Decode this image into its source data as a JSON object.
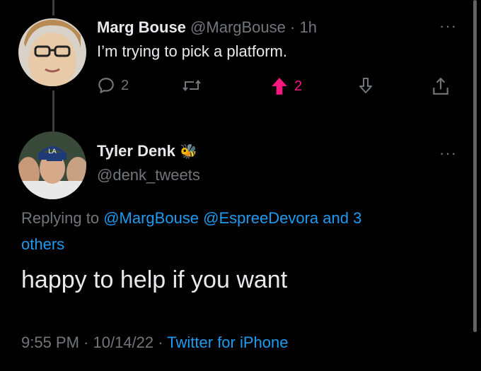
{
  "tweet1": {
    "author_name": "Marg Bouse",
    "author_handle": "@MargBouse",
    "separator": "·",
    "time": "1h",
    "text": "I’m trying to pick a platform.",
    "reply_count": "2",
    "upvote_count": "2"
  },
  "tweet2": {
    "author_name": "Tyler Denk",
    "author_emoji": "🐝",
    "author_handle": "@denk_tweets",
    "replying_prefix": "Replying to",
    "mention_1": "@MargBouse",
    "mention_2": "@EspreeDevora",
    "and_others_1": "and 3",
    "and_others_2": "others",
    "text": "happy to help if you want",
    "timestamp": "9:55 PM · 10/14/22",
    "timestamp_separator": "·",
    "source": "Twitter for iPhone"
  },
  "colors": {
    "background": "#000000",
    "text": "#e7e9ea",
    "muted": "#71767b",
    "link": "#1d9bf0",
    "upvote": "#f91880"
  }
}
